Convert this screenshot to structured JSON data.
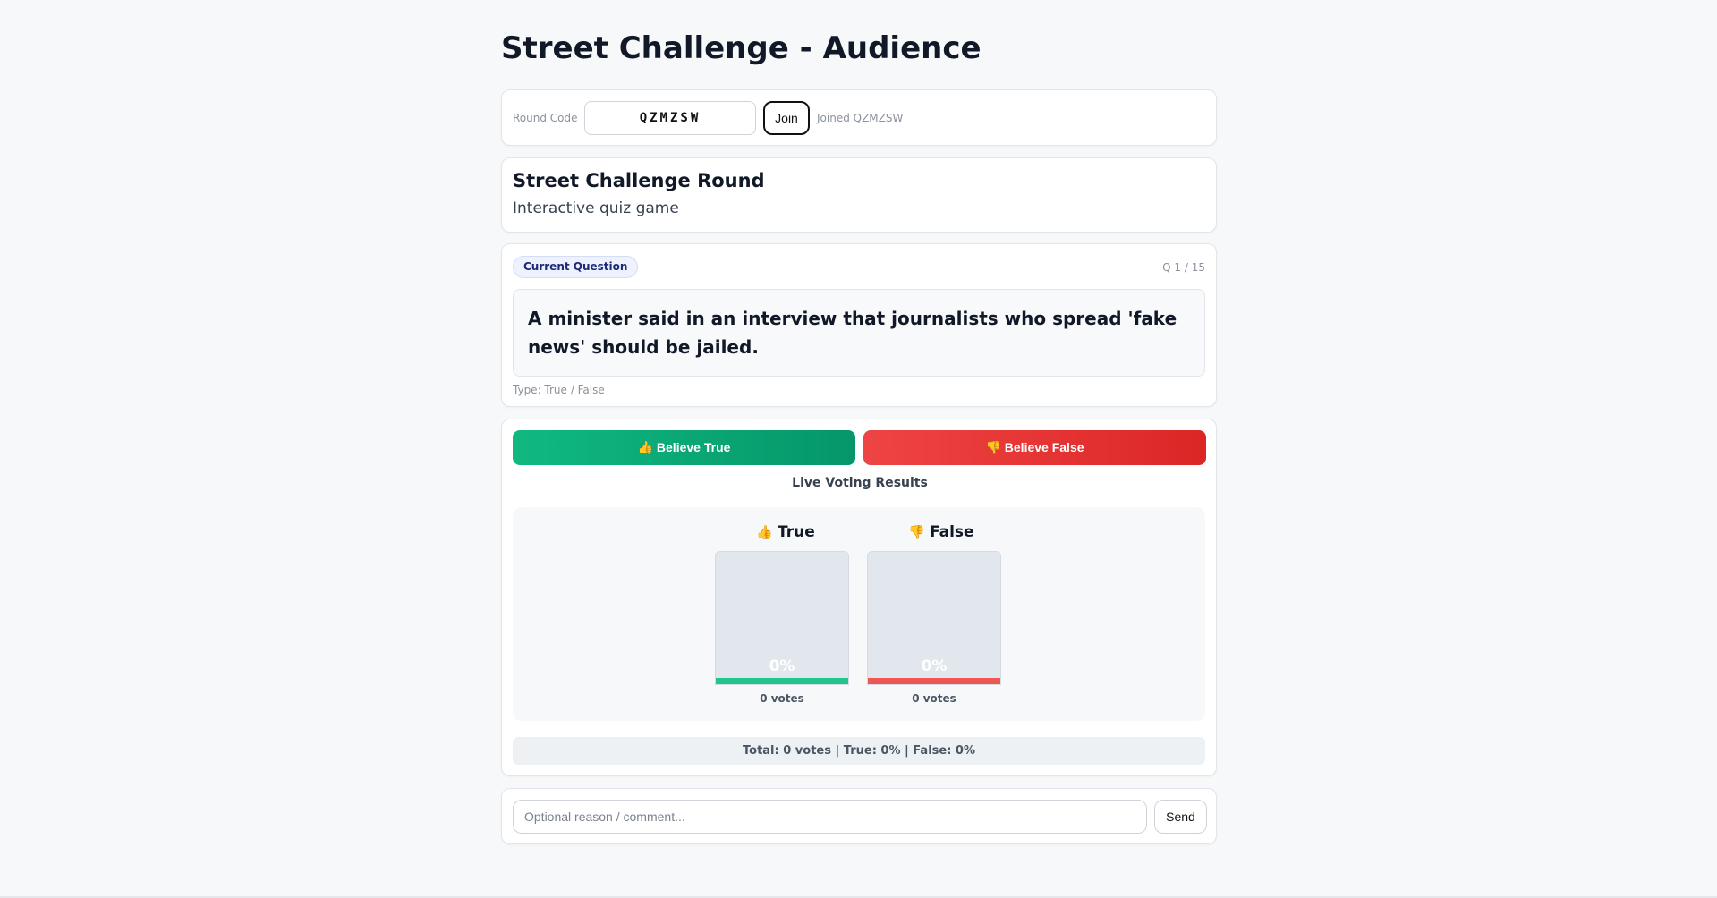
{
  "page": {
    "title": "Street Challenge - Audience"
  },
  "join": {
    "round_code_label": "Round Code",
    "code_value": "QZMZSW",
    "join_label": "Join",
    "joined_status": "Joined QZMZSW"
  },
  "round": {
    "title": "Street Challenge Round",
    "subtitle": "Interactive quiz game"
  },
  "question": {
    "badge": "Current Question",
    "counter": "Q 1 / 15",
    "text": "A minister said in an interview that journalists who spread 'fake news' should be jailed.",
    "type": "Type: True / False"
  },
  "vote": {
    "believe_true_label": "👍 Believe True",
    "believe_false_label": "👎 Believe False"
  },
  "results": {
    "title": "Live Voting Results",
    "options": [
      {
        "label": "True",
        "icon": "thumbs-up-icon",
        "icon_glyph": "👍",
        "percent": 0,
        "percent_label": "0%",
        "votes_label": "0 votes",
        "color": "#22c58b"
      },
      {
        "label": "False",
        "icon": "thumbs-down-icon",
        "icon_glyph": "👎",
        "percent": 0,
        "percent_label": "0%",
        "votes_label": "0 votes",
        "color": "#ef5656"
      }
    ],
    "summary": "Total: 0 votes | True: 0% | False: 0%"
  },
  "comment": {
    "placeholder": "Optional reason / comment...",
    "send_label": "Send"
  },
  "colors": {
    "true_accent": "#10b981",
    "false_accent": "#ef4444",
    "badge_text": "#1e2a78"
  }
}
